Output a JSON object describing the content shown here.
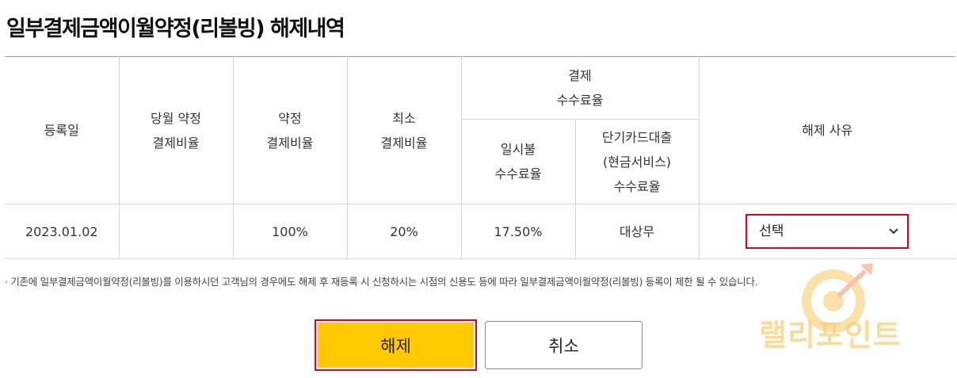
{
  "title": "일부결제금액이월약정(리볼빙) 해제내역",
  "table": {
    "headers": {
      "reg_date": "등록일",
      "month_rate": [
        "당월 약정",
        "결제비율"
      ],
      "agreed_rate": [
        "약정",
        "결제비율"
      ],
      "min_rate": [
        "최소",
        "결제비율"
      ],
      "fee_group": [
        "결제",
        "수수료율"
      ],
      "lump_fee": [
        "일시불",
        "수수료율"
      ],
      "cash_fee": [
        "단기카드대출",
        "(현금서비스)",
        "수수료율"
      ],
      "reason": "해제 사유"
    },
    "row": {
      "reg_date": "2023.01.02",
      "month_rate": "",
      "agreed_rate": "100%",
      "min_rate": "20%",
      "lump_fee": "17.50%",
      "cash_fee": "대상무",
      "reason_selected": "선택"
    }
  },
  "note": "· 기존에 일부결제금액이월약정(리볼빙)를 이용하시던 고객님의 경우에도 해제 후 재등록 시 신청하시는 시점의 신용도 등에 따라 일부결제금액이월약정(리볼빙) 등록이 제한 될 수 있습니다.",
  "buttons": {
    "confirm": "해제",
    "cancel": "취소"
  },
  "watermark": "랠리포인트",
  "colors": {
    "accent_yellow": "#ffc800",
    "highlight_red": "#e0001b",
    "watermark_orange": "#f5b43c"
  },
  "icons": {
    "dropdown": "chevron-down-icon",
    "watermark_logo": "target-arrow-icon"
  }
}
